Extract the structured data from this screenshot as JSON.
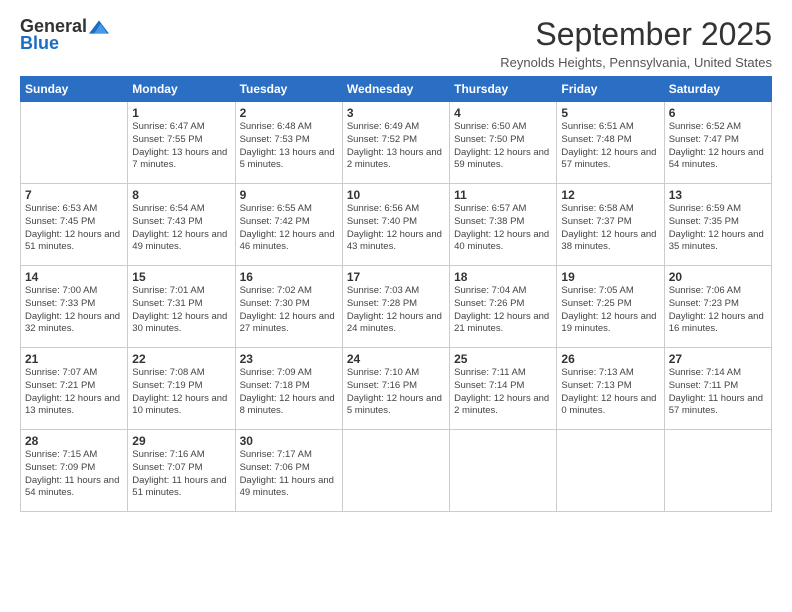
{
  "logo": {
    "general": "General",
    "blue": "Blue"
  },
  "title": "September 2025",
  "location": "Reynolds Heights, Pennsylvania, United States",
  "days_of_week": [
    "Sunday",
    "Monday",
    "Tuesday",
    "Wednesday",
    "Thursday",
    "Friday",
    "Saturday"
  ],
  "weeks": [
    [
      {
        "day": "",
        "sunrise": "",
        "sunset": "",
        "daylight": ""
      },
      {
        "day": "1",
        "sunrise": "Sunrise: 6:47 AM",
        "sunset": "Sunset: 7:55 PM",
        "daylight": "Daylight: 13 hours and 7 minutes."
      },
      {
        "day": "2",
        "sunrise": "Sunrise: 6:48 AM",
        "sunset": "Sunset: 7:53 PM",
        "daylight": "Daylight: 13 hours and 5 minutes."
      },
      {
        "day": "3",
        "sunrise": "Sunrise: 6:49 AM",
        "sunset": "Sunset: 7:52 PM",
        "daylight": "Daylight: 13 hours and 2 minutes."
      },
      {
        "day": "4",
        "sunrise": "Sunrise: 6:50 AM",
        "sunset": "Sunset: 7:50 PM",
        "daylight": "Daylight: 12 hours and 59 minutes."
      },
      {
        "day": "5",
        "sunrise": "Sunrise: 6:51 AM",
        "sunset": "Sunset: 7:48 PM",
        "daylight": "Daylight: 12 hours and 57 minutes."
      },
      {
        "day": "6",
        "sunrise": "Sunrise: 6:52 AM",
        "sunset": "Sunset: 7:47 PM",
        "daylight": "Daylight: 12 hours and 54 minutes."
      }
    ],
    [
      {
        "day": "7",
        "sunrise": "Sunrise: 6:53 AM",
        "sunset": "Sunset: 7:45 PM",
        "daylight": "Daylight: 12 hours and 51 minutes."
      },
      {
        "day": "8",
        "sunrise": "Sunrise: 6:54 AM",
        "sunset": "Sunset: 7:43 PM",
        "daylight": "Daylight: 12 hours and 49 minutes."
      },
      {
        "day": "9",
        "sunrise": "Sunrise: 6:55 AM",
        "sunset": "Sunset: 7:42 PM",
        "daylight": "Daylight: 12 hours and 46 minutes."
      },
      {
        "day": "10",
        "sunrise": "Sunrise: 6:56 AM",
        "sunset": "Sunset: 7:40 PM",
        "daylight": "Daylight: 12 hours and 43 minutes."
      },
      {
        "day": "11",
        "sunrise": "Sunrise: 6:57 AM",
        "sunset": "Sunset: 7:38 PM",
        "daylight": "Daylight: 12 hours and 40 minutes."
      },
      {
        "day": "12",
        "sunrise": "Sunrise: 6:58 AM",
        "sunset": "Sunset: 7:37 PM",
        "daylight": "Daylight: 12 hours and 38 minutes."
      },
      {
        "day": "13",
        "sunrise": "Sunrise: 6:59 AM",
        "sunset": "Sunset: 7:35 PM",
        "daylight": "Daylight: 12 hours and 35 minutes."
      }
    ],
    [
      {
        "day": "14",
        "sunrise": "Sunrise: 7:00 AM",
        "sunset": "Sunset: 7:33 PM",
        "daylight": "Daylight: 12 hours and 32 minutes."
      },
      {
        "day": "15",
        "sunrise": "Sunrise: 7:01 AM",
        "sunset": "Sunset: 7:31 PM",
        "daylight": "Daylight: 12 hours and 30 minutes."
      },
      {
        "day": "16",
        "sunrise": "Sunrise: 7:02 AM",
        "sunset": "Sunset: 7:30 PM",
        "daylight": "Daylight: 12 hours and 27 minutes."
      },
      {
        "day": "17",
        "sunrise": "Sunrise: 7:03 AM",
        "sunset": "Sunset: 7:28 PM",
        "daylight": "Daylight: 12 hours and 24 minutes."
      },
      {
        "day": "18",
        "sunrise": "Sunrise: 7:04 AM",
        "sunset": "Sunset: 7:26 PM",
        "daylight": "Daylight: 12 hours and 21 minutes."
      },
      {
        "day": "19",
        "sunrise": "Sunrise: 7:05 AM",
        "sunset": "Sunset: 7:25 PM",
        "daylight": "Daylight: 12 hours and 19 minutes."
      },
      {
        "day": "20",
        "sunrise": "Sunrise: 7:06 AM",
        "sunset": "Sunset: 7:23 PM",
        "daylight": "Daylight: 12 hours and 16 minutes."
      }
    ],
    [
      {
        "day": "21",
        "sunrise": "Sunrise: 7:07 AM",
        "sunset": "Sunset: 7:21 PM",
        "daylight": "Daylight: 12 hours and 13 minutes."
      },
      {
        "day": "22",
        "sunrise": "Sunrise: 7:08 AM",
        "sunset": "Sunset: 7:19 PM",
        "daylight": "Daylight: 12 hours and 10 minutes."
      },
      {
        "day": "23",
        "sunrise": "Sunrise: 7:09 AM",
        "sunset": "Sunset: 7:18 PM",
        "daylight": "Daylight: 12 hours and 8 minutes."
      },
      {
        "day": "24",
        "sunrise": "Sunrise: 7:10 AM",
        "sunset": "Sunset: 7:16 PM",
        "daylight": "Daylight: 12 hours and 5 minutes."
      },
      {
        "day": "25",
        "sunrise": "Sunrise: 7:11 AM",
        "sunset": "Sunset: 7:14 PM",
        "daylight": "Daylight: 12 hours and 2 minutes."
      },
      {
        "day": "26",
        "sunrise": "Sunrise: 7:13 AM",
        "sunset": "Sunset: 7:13 PM",
        "daylight": "Daylight: 12 hours and 0 minutes."
      },
      {
        "day": "27",
        "sunrise": "Sunrise: 7:14 AM",
        "sunset": "Sunset: 7:11 PM",
        "daylight": "Daylight: 11 hours and 57 minutes."
      }
    ],
    [
      {
        "day": "28",
        "sunrise": "Sunrise: 7:15 AM",
        "sunset": "Sunset: 7:09 PM",
        "daylight": "Daylight: 11 hours and 54 minutes."
      },
      {
        "day": "29",
        "sunrise": "Sunrise: 7:16 AM",
        "sunset": "Sunset: 7:07 PM",
        "daylight": "Daylight: 11 hours and 51 minutes."
      },
      {
        "day": "30",
        "sunrise": "Sunrise: 7:17 AM",
        "sunset": "Sunset: 7:06 PM",
        "daylight": "Daylight: 11 hours and 49 minutes."
      },
      {
        "day": "",
        "sunrise": "",
        "sunset": "",
        "daylight": ""
      },
      {
        "day": "",
        "sunrise": "",
        "sunset": "",
        "daylight": ""
      },
      {
        "day": "",
        "sunrise": "",
        "sunset": "",
        "daylight": ""
      },
      {
        "day": "",
        "sunrise": "",
        "sunset": "",
        "daylight": ""
      }
    ]
  ]
}
